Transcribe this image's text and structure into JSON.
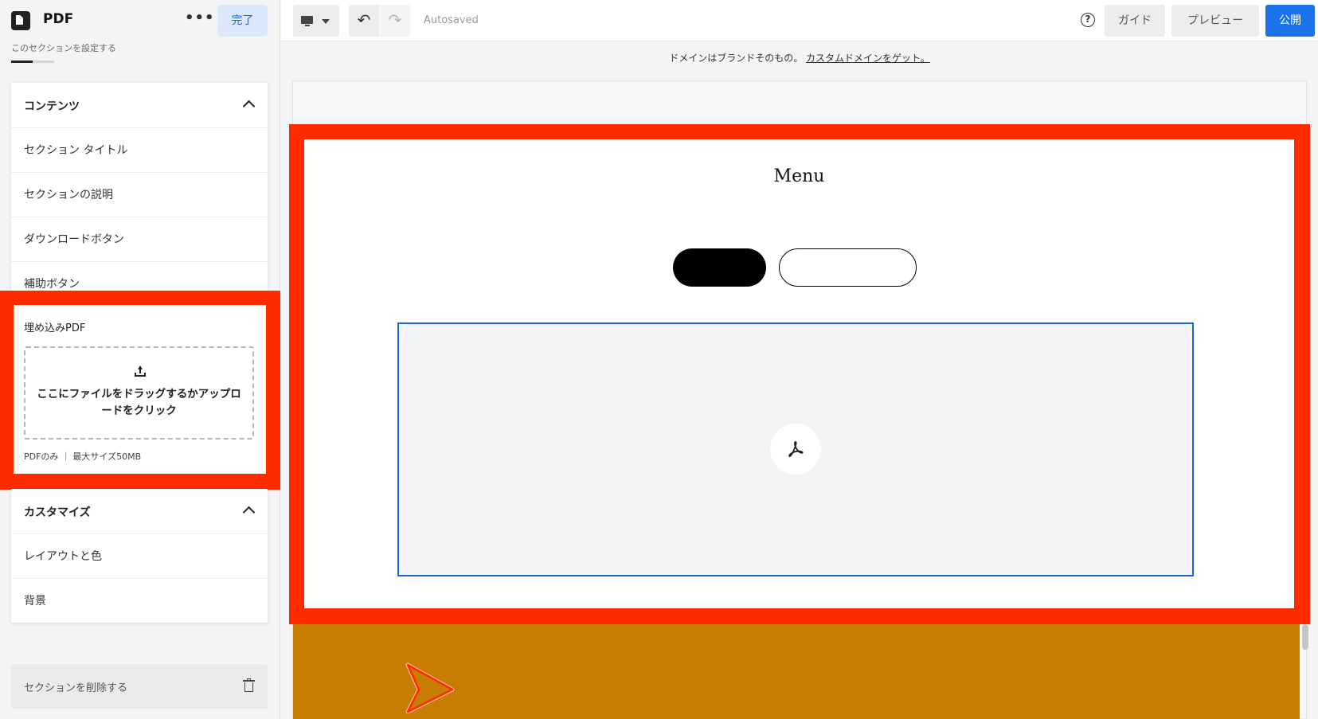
{
  "sidebar": {
    "title": "PDF",
    "more": "•••",
    "done": "完了",
    "subtitle": "このセクションを設定する",
    "progress": 0.5,
    "content": {
      "header": "コンテンツ",
      "items": [
        "セクション タイトル",
        "セクションの説明",
        "ダウンロードボタン",
        "補助ボタン"
      ]
    },
    "embed": {
      "label": "埋め込みPDF",
      "dropzone": "ここにファイルをドラッグするかアップロードをクリック",
      "hint": "PDFのみ ｜ 最大サイズ50MB"
    },
    "customize": {
      "header": "カスタマイズ",
      "items": [
        "レイアウトと色",
        "背景"
      ]
    },
    "delete": "セクションを削除する"
  },
  "toolbar": {
    "undo": "↶",
    "redo": "↷",
    "autosaved": "Autosaved",
    "help": "?",
    "guide": "ガイド",
    "preview": "プレビュー",
    "publish": "公開"
  },
  "canvas": {
    "banner_text": "ドメインはブランドそのもの。",
    "banner_link": "カスタムドメインをゲット。",
    "section_title": "Menu"
  },
  "colors": {
    "highlight": "#ff2a00",
    "accent": "#1a73e8",
    "orange_section": "#c77d00"
  }
}
